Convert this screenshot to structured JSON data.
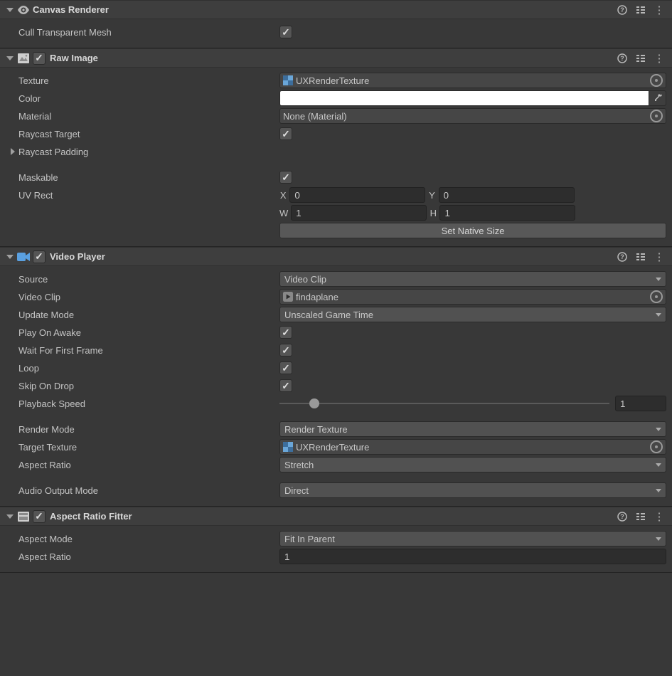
{
  "canvasRenderer": {
    "title": "Canvas Renderer",
    "cullTransparentMeshLabel": "Cull Transparent Mesh",
    "cullTransparentMesh": true
  },
  "rawImage": {
    "title": "Raw Image",
    "enabled": true,
    "textureLabel": "Texture",
    "texture": "UXRenderTexture",
    "colorLabel": "Color",
    "color": "#FFFFFF",
    "materialLabel": "Material",
    "material": "None (Material)",
    "raycastTargetLabel": "Raycast Target",
    "raycastTarget": true,
    "raycastPaddingLabel": "Raycast Padding",
    "maskableLabel": "Maskable",
    "maskable": true,
    "uvRectLabel": "UV Rect",
    "uvRect": {
      "xLabel": "X",
      "x": "0",
      "yLabel": "Y",
      "y": "0",
      "wLabel": "W",
      "w": "1",
      "hLabel": "H",
      "h": "1"
    },
    "setNativeSizeLabel": "Set Native Size"
  },
  "videoPlayer": {
    "title": "Video Player",
    "enabled": true,
    "sourceLabel": "Source",
    "source": "Video Clip",
    "videoClipLabel": "Video Clip",
    "videoClip": "findaplane",
    "updateModeLabel": "Update Mode",
    "updateMode": "Unscaled Game Time",
    "playOnAwakeLabel": "Play On Awake",
    "playOnAwake": true,
    "waitForFirstFrameLabel": "Wait For First Frame",
    "waitForFirstFrame": true,
    "loopLabel": "Loop",
    "loop": true,
    "skipOnDropLabel": "Skip On Drop",
    "skipOnDrop": true,
    "playbackSpeedLabel": "Playback Speed",
    "playbackSpeed": "1",
    "renderModeLabel": "Render Mode",
    "renderMode": "Render Texture",
    "targetTextureLabel": "Target Texture",
    "targetTexture": "UXRenderTexture",
    "aspectRatioLabel": "Aspect Ratio",
    "aspectRatio": "Stretch",
    "audioOutputModeLabel": "Audio Output Mode",
    "audioOutputMode": "Direct"
  },
  "aspectRatioFitter": {
    "title": "Aspect Ratio Fitter",
    "enabled": true,
    "aspectModeLabel": "Aspect Mode",
    "aspectMode": "Fit In Parent",
    "aspectRatioLabel": "Aspect Ratio",
    "aspectRatio": "1"
  }
}
